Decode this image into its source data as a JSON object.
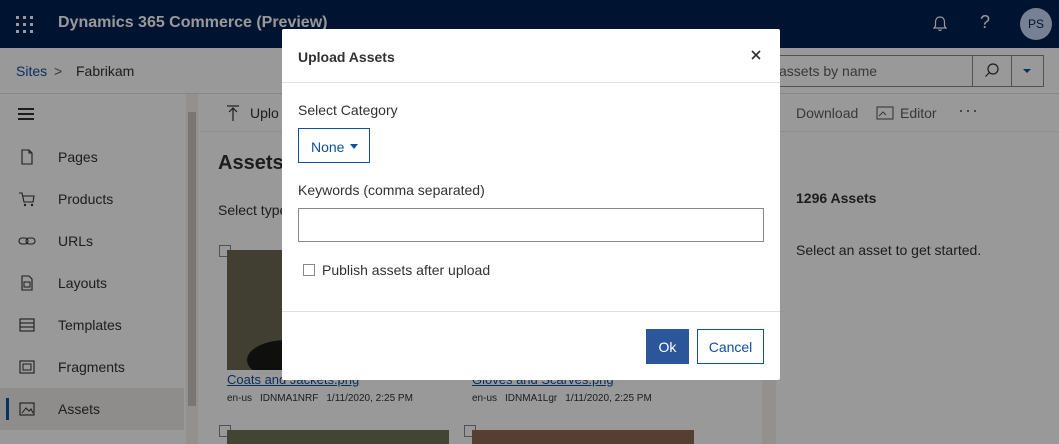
{
  "header": {
    "app_title": "Dynamics 365 Commerce (Preview)",
    "help_glyph": "?",
    "avatar_initials": "PS",
    "waffle_icon": "waffle-icon",
    "bell_icon": "bell-icon"
  },
  "breadcrumb": {
    "root": "Sites",
    "separator": ">",
    "current": "Fabrikam"
  },
  "search": {
    "value": "assets by name"
  },
  "sidebar": {
    "items": [
      {
        "label": "Pages",
        "icon": "page-icon"
      },
      {
        "label": "Products",
        "icon": "cart-icon"
      },
      {
        "label": "URLs",
        "icon": "link-icon"
      },
      {
        "label": "Layouts",
        "icon": "layout-icon"
      },
      {
        "label": "Templates",
        "icon": "template-icon"
      },
      {
        "label": "Fragments",
        "icon": "fragment-icon"
      },
      {
        "label": "Assets",
        "icon": "image-icon",
        "active": true
      }
    ]
  },
  "commandbar": {
    "upload": "Uplo",
    "download": "Download",
    "editor": "Editor",
    "more": "···"
  },
  "main": {
    "title": "Assets",
    "select_type": "Select type",
    "assets": [
      {
        "name": "Coats and Jackets.png",
        "locale": "en-us",
        "id": "IDNMA1NRF",
        "date": "1/11/2020, 2:25 PM"
      },
      {
        "name": "Gloves and Scarves.png",
        "locale": "en-us",
        "id": "IDNMA1Lgr",
        "date": "1/11/2020, 2:25 PM"
      }
    ]
  },
  "details": {
    "count": "1296 Assets",
    "hint": "Select an asset to get started."
  },
  "dialog": {
    "title": "Upload Assets",
    "close_glyph": "×",
    "category_label": "Select Category",
    "category_value": "None",
    "keywords_label": "Keywords (comma separated)",
    "keywords_value": "",
    "publish_label": "Publish assets after upload",
    "publish_checked": false,
    "ok": "Ok",
    "cancel": "Cancel"
  },
  "colors": {
    "topbar": "#002050",
    "accent": "#0f4f9e",
    "ok_button": "#2b579a"
  }
}
